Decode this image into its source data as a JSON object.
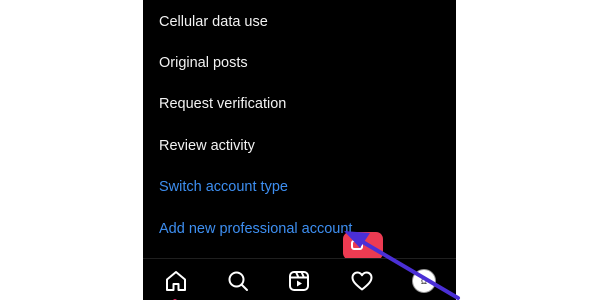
{
  "menu": {
    "items": [
      {
        "label": "Cellular data use"
      },
      {
        "label": "Original posts"
      },
      {
        "label": "Request verification"
      },
      {
        "label": "Review activity"
      },
      {
        "label": "Switch account type"
      },
      {
        "label": "Add new professional account"
      }
    ]
  },
  "bottom_nav": {
    "icons": [
      "home-icon",
      "search-icon",
      "reels-icon",
      "heart-icon",
      "profile-avatar"
    ],
    "active": "home-icon"
  },
  "avatar": {
    "text": "Ω"
  },
  "colors": {
    "background": "#000000",
    "text": "#f2f2f2",
    "link": "#3d8ef0",
    "badge": "#ec3b52",
    "annotation_arrow": "#4a2fd6"
  }
}
